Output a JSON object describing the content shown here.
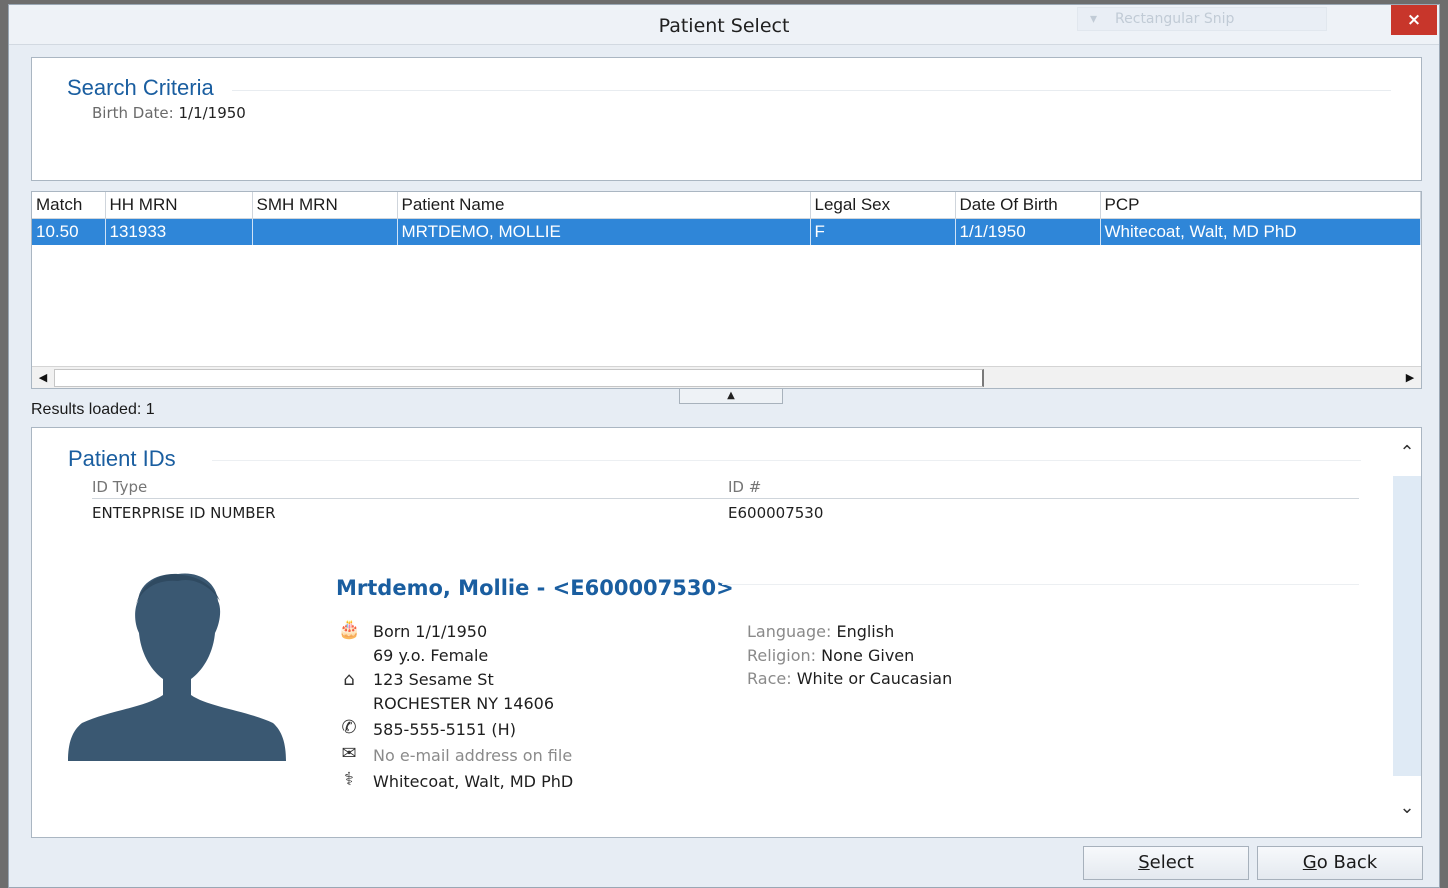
{
  "window": {
    "title": "Patient Select",
    "ghost_overlay": "Rectangular Snip",
    "close_label": "×"
  },
  "search_criteria": {
    "title": "Search Criteria",
    "label": "Birth Date:",
    "value": "1/1/1950"
  },
  "results": {
    "columns": [
      "Match",
      "HH MRN",
      "SMH MRN",
      "Patient Name",
      "Legal Sex",
      "Date Of Birth",
      "PCP"
    ],
    "rows": [
      [
        "10.50",
        "131933",
        "",
        "MRTDEMO, MOLLIE",
        "F",
        "1/1/1950",
        "Whitecoat, Walt, MD PhD"
      ]
    ],
    "selected_row": 0,
    "status": "Results loaded: 1"
  },
  "patient_ids": {
    "title": "Patient IDs",
    "col_type": "ID Type",
    "col_num": "ID #",
    "type": "ENTERPRISE ID NUMBER",
    "number": "E600007530"
  },
  "patient": {
    "header": "Mrtdemo, Mollie - <E600007530>",
    "born": "Born 1/1/1950",
    "age_sex": "69 y.o. Female",
    "address1": "123 Sesame St",
    "address2": "ROCHESTER NY 14606",
    "phone": "585-555-5151 (H)",
    "email": "No e-mail address on file",
    "pcp": "Whitecoat, Walt, MD PhD",
    "language_label": "Language:",
    "language": "English",
    "religion_label": "Religion:",
    "religion": "None Given",
    "race_label": "Race:",
    "race": "White or Caucasian"
  },
  "icons": {
    "birthday": "cake-icon",
    "address": "home-icon",
    "phone": "phone-icon",
    "email": "mail-icon",
    "pcp": "stethoscope-icon"
  },
  "buttons": {
    "select_mnemonic": "S",
    "select_rest": "elect",
    "goback_mnemonic": "G",
    "goback_rest": "o Back"
  },
  "colors": {
    "accent": "#1a5ea0",
    "selection": "#2f86d8",
    "close": "#c8362b"
  }
}
